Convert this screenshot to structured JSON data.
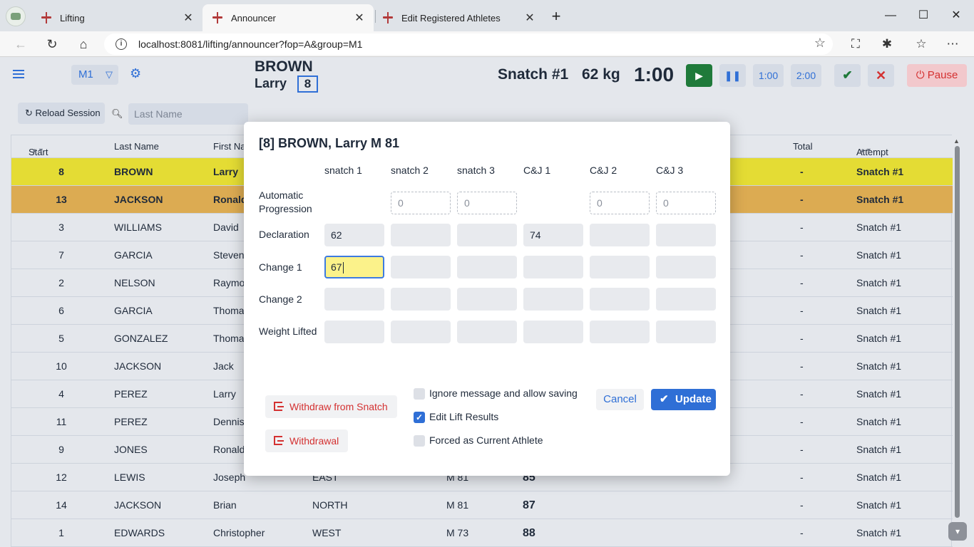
{
  "browser": {
    "tabs": [
      {
        "title": "Lifting"
      },
      {
        "title": "Announcer"
      },
      {
        "title": "Edit Registered Athletes"
      }
    ],
    "url": "localhost:8081/lifting/announcer?fop=A&group=M1",
    "icons": [
      "back-icon",
      "refresh-icon",
      "home-icon",
      "info-icon",
      "favorite-star-icon",
      "screenshot-icon",
      "extensions-icon",
      "favorites-icon",
      "more-icon"
    ]
  },
  "header": {
    "group": "M1",
    "athlete_last": "BROWN",
    "athlete_first": "Larry",
    "athlete_number": "8",
    "attempt": "Snatch #1",
    "weight": "62 kg",
    "clock": "1:00",
    "timer_1": "1:00",
    "timer_2": "2:00",
    "pause_label": "Pause",
    "colors": {
      "accent": "#2f6fd6",
      "good": "#1f7a3a",
      "bad": "#d43131"
    }
  },
  "toolbar": {
    "reload_label": "Reload Session",
    "search_placeholder": "Last Name"
  },
  "grid": {
    "columns": {
      "start_number": "Start Number",
      "last_name": "Last Name",
      "first_name": "First Name",
      "total": "Total",
      "attempt": "Attempt"
    },
    "rows": [
      {
        "start": "8",
        "last": "BROWN",
        "first": "Larry",
        "team": "",
        "cat": "",
        "wt": "",
        "total": "-",
        "attempt": "Snatch #1"
      },
      {
        "start": "13",
        "last": "JACKSON",
        "first": "Ronald",
        "team": "",
        "cat": "",
        "wt": "",
        "total": "-",
        "attempt": "Snatch #1"
      },
      {
        "start": "3",
        "last": "WILLIAMS",
        "first": "David",
        "team": "",
        "cat": "",
        "wt": "",
        "total": "-",
        "attempt": "Snatch #1"
      },
      {
        "start": "7",
        "last": "GARCIA",
        "first": "Steven",
        "team": "",
        "cat": "",
        "wt": "",
        "total": "-",
        "attempt": "Snatch #1"
      },
      {
        "start": "2",
        "last": "NELSON",
        "first": "Raymond",
        "team": "",
        "cat": "",
        "wt": "",
        "total": "-",
        "attempt": "Snatch #1"
      },
      {
        "start": "6",
        "last": "GARCIA",
        "first": "Thomas",
        "team": "",
        "cat": "",
        "wt": "",
        "total": "-",
        "attempt": "Snatch #1"
      },
      {
        "start": "5",
        "last": "GONZALEZ",
        "first": "Thomas",
        "team": "",
        "cat": "",
        "wt": "",
        "total": "-",
        "attempt": "Snatch #1"
      },
      {
        "start": "10",
        "last": "JACKSON",
        "first": "Jack",
        "team": "",
        "cat": "",
        "wt": "",
        "total": "-",
        "attempt": "Snatch #1"
      },
      {
        "start": "4",
        "last": "PEREZ",
        "first": "Larry",
        "team": "",
        "cat": "",
        "wt": "",
        "total": "-",
        "attempt": "Snatch #1"
      },
      {
        "start": "11",
        "last": "PEREZ",
        "first": "Dennis",
        "team": "",
        "cat": "",
        "wt": "",
        "total": "-",
        "attempt": "Snatch #1"
      },
      {
        "start": "9",
        "last": "JONES",
        "first": "Ronald",
        "team": "",
        "cat": "",
        "wt": "",
        "total": "-",
        "attempt": "Snatch #1"
      },
      {
        "start": "12",
        "last": "LEWIS",
        "first": "Joseph",
        "team": "EAST",
        "cat": "M 81",
        "wt": "85",
        "total": "-",
        "attempt": "Snatch #1"
      },
      {
        "start": "14",
        "last": "JACKSON",
        "first": "Brian",
        "team": "NORTH",
        "cat": "M 81",
        "wt": "87",
        "total": "-",
        "attempt": "Snatch #1"
      },
      {
        "start": "1",
        "last": "EDWARDS",
        "first": "Christopher",
        "team": "WEST",
        "cat": "M 73",
        "wt": "88",
        "total": "-",
        "attempt": "Snatch #1"
      }
    ]
  },
  "dialog": {
    "title": "[8] BROWN, Larry M 81",
    "columns": [
      "snatch 1",
      "snatch 2",
      "snatch 3",
      "C&J 1",
      "C&J 2",
      "C&J 3"
    ],
    "rows": {
      "auto_label": "Automatic Progression",
      "decl_label": "Declaration",
      "change1_label": "Change 1",
      "change2_label": "Change 2",
      "lifted_label": "Weight Lifted"
    },
    "auto_values": [
      "",
      "0",
      "0",
      "",
      "0",
      "0"
    ],
    "decl_values": [
      "62",
      "",
      "",
      "74",
      "",
      ""
    ],
    "change1_values": [
      "67",
      "",
      "",
      "",
      "",
      ""
    ],
    "withdraw_snatch_label": "Withdraw from Snatch",
    "withdrawal_label": "Withdrawal",
    "checkbox_ignore": "Ignore message and allow saving",
    "checkbox_edit": "Edit Lift Results",
    "checkbox_forced": "Forced as Current Athlete",
    "cancel_label": "Cancel",
    "update_label": "Update"
  }
}
